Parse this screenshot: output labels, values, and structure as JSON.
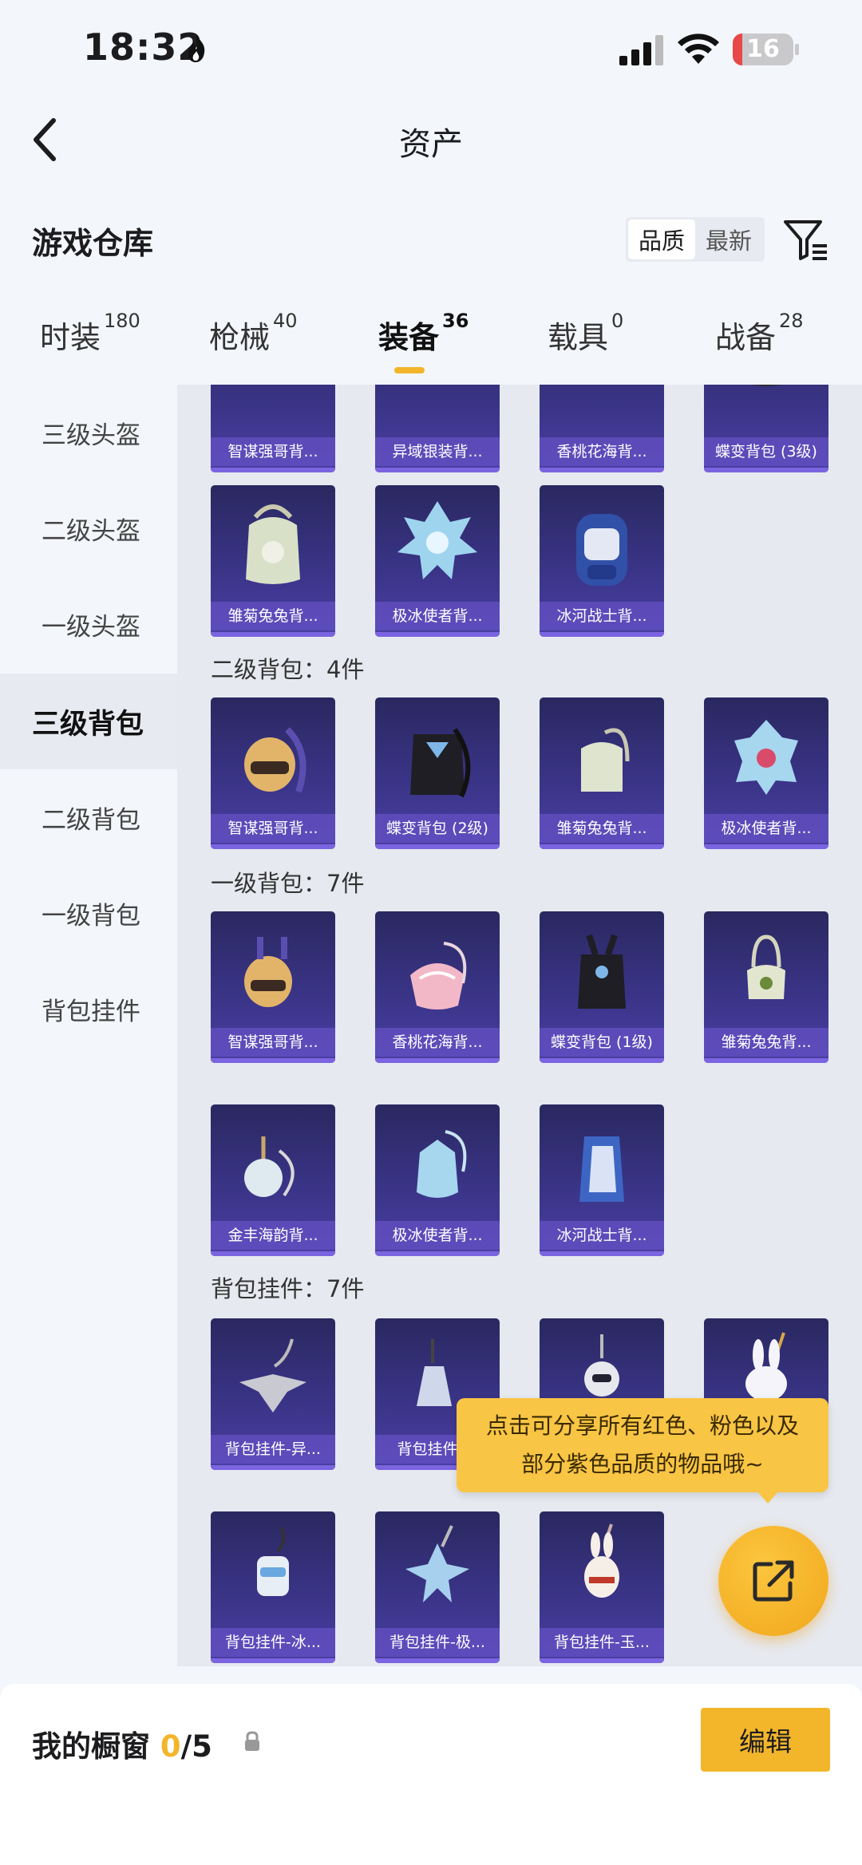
{
  "status": {
    "time": "18:32",
    "battery": "16",
    "battery_level": 0.16
  },
  "header": {
    "title": "资产"
  },
  "warehouse": {
    "title": "游戏仓库",
    "sort_options": [
      "品质",
      "最新"
    ]
  },
  "tabs": [
    {
      "label": "时装",
      "count": "180"
    },
    {
      "label": "枪械",
      "count": "40"
    },
    {
      "label": "装备",
      "count": "36"
    },
    {
      "label": "载具",
      "count": "0"
    },
    {
      "label": "战备",
      "count": "28"
    }
  ],
  "sidebar": {
    "items": [
      "三级头盔",
      "二级头盔",
      "一级头盔",
      "三级背包",
      "二级背包",
      "一级背包",
      "背包挂件"
    ],
    "active": "三级背包"
  },
  "sections": {
    "top_partial": [
      "智谋强哥背...",
      "异域银装背...",
      "香桃花海背...",
      "蝶变背包 (3级)"
    ],
    "level3_row2": [
      "雏菊兔兔背...",
      "极冰使者背...",
      "冰河战士背..."
    ],
    "level2": {
      "label": "二级背包：4件",
      "items": [
        "智谋强哥背...",
        "蝶变背包 (2级)",
        "雏菊兔兔背...",
        "极冰使者背..."
      ]
    },
    "level1": {
      "label": "一级背包：7件",
      "row1": [
        "智谋强哥背...",
        "香桃花海背...",
        "蝶变背包 (1级)",
        "雏菊兔兔背..."
      ],
      "row2": [
        "金丰海韵背...",
        "极冰使者背...",
        "冰河战士背..."
      ]
    },
    "charms": {
      "label": "背包挂件：7件",
      "row1": [
        "背包挂件-异...",
        "背包挂件-...",
        "",
        ""
      ],
      "row2": [
        "背包挂件-冰...",
        "背包挂件-极...",
        "背包挂件-玉..."
      ]
    }
  },
  "tooltip": {
    "line1": "点击可分享所有红色、粉色以及",
    "line2": "部分紫色品质的物品哦~"
  },
  "bottom": {
    "label": "我的橱窗",
    "count": "0",
    "total": "/5",
    "edit": "编辑"
  },
  "colors": {
    "accent": "#f3b62b",
    "card": "#3a3487"
  }
}
